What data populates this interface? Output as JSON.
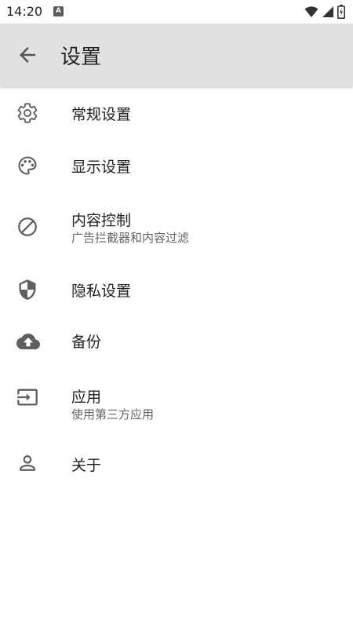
{
  "status_bar": {
    "time": "14:20",
    "notification_icon": "A",
    "icons": [
      "wifi-icon",
      "signal-icon",
      "battery-icon"
    ]
  },
  "app_bar": {
    "back_icon": "arrow-left-icon",
    "title": "设置"
  },
  "settings": [
    {
      "icon": "gear-icon",
      "title": "常规设置"
    },
    {
      "icon": "palette-icon",
      "title": "显示设置"
    },
    {
      "icon": "block-icon",
      "title": "内容控制",
      "subtitle": "广告拦截器和内容过滤"
    },
    {
      "icon": "shield-icon",
      "title": "隐私设置"
    },
    {
      "icon": "cloud-upload-icon",
      "title": "备份"
    },
    {
      "icon": "input-icon",
      "title": "应用",
      "subtitle": "使用第三方应用"
    },
    {
      "icon": "person-icon",
      "title": "关于"
    }
  ],
  "colors": {
    "app_bar_bg": "#e1e1e1",
    "icon": "#5f5f5f",
    "text": "#222222",
    "subtext": "#666666"
  }
}
